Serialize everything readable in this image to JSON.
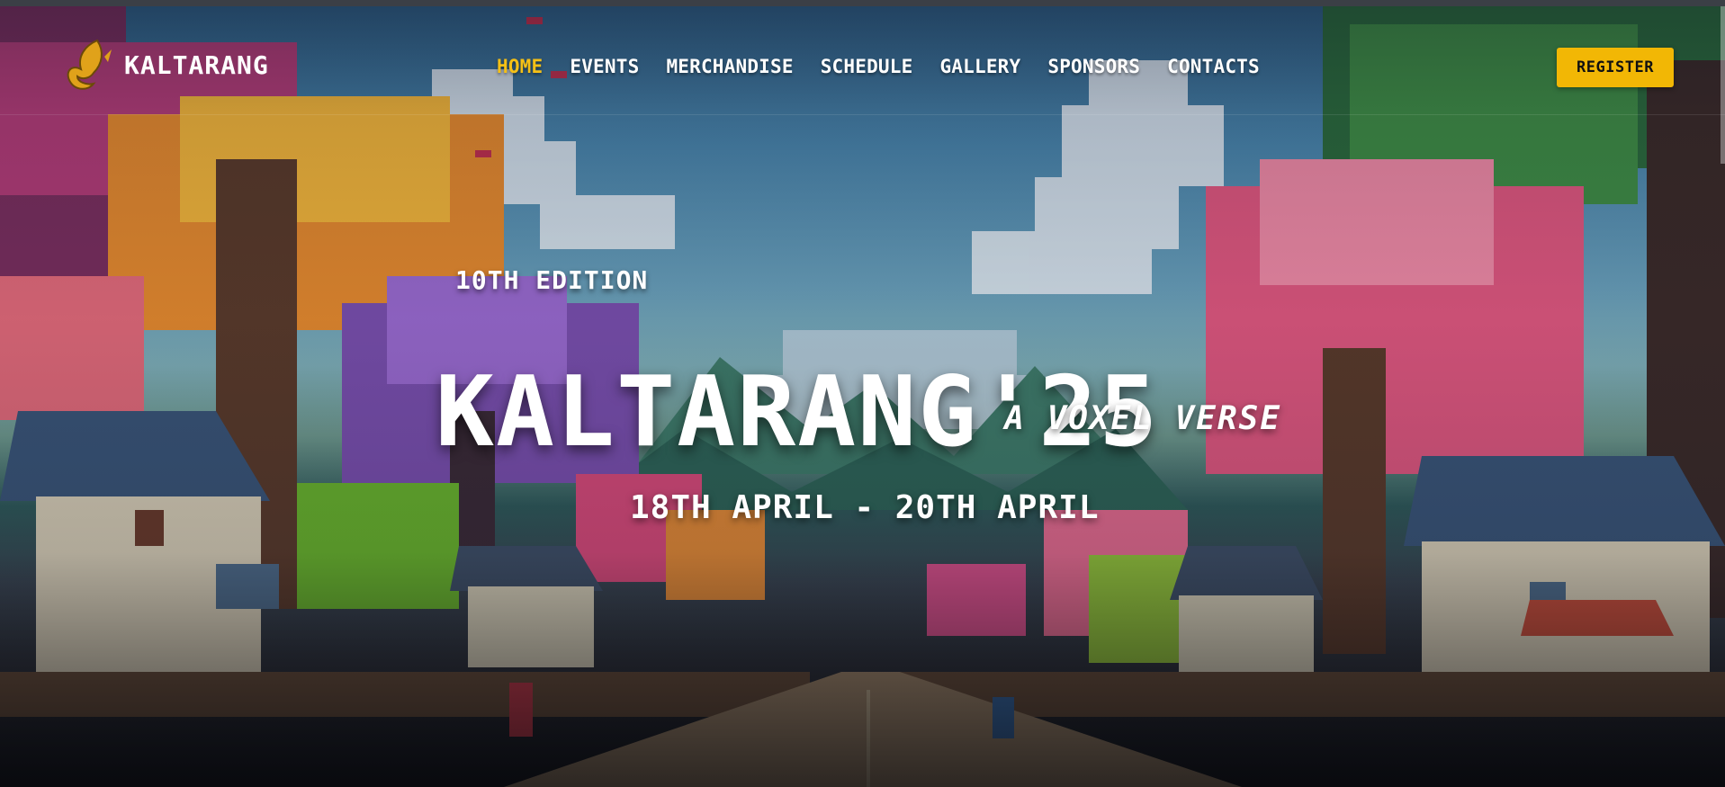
{
  "brand": {
    "name": "KALTARANG",
    "logo": "winged-k-logo-icon"
  },
  "nav": {
    "items": [
      {
        "label": "HOME",
        "active": true
      },
      {
        "label": "EVENTS"
      },
      {
        "label": "MERCHANDISE"
      },
      {
        "label": "SCHEDULE"
      },
      {
        "label": "GALLERY"
      },
      {
        "label": "SPONSORS"
      },
      {
        "label": "CONTACTS"
      }
    ],
    "register_label": "REGISTER"
  },
  "hero": {
    "edition": "10TH EDITION",
    "title": "KALTARANG'25",
    "tagline": "A VOXEL VERSE",
    "dates": "18TH APRIL - 20TH APRIL",
    "background": "pixel-art village street lined with colorful trees and houses"
  },
  "colors": {
    "accent": "#f5c016",
    "button": "#f2b705",
    "text": "#ffffff"
  }
}
